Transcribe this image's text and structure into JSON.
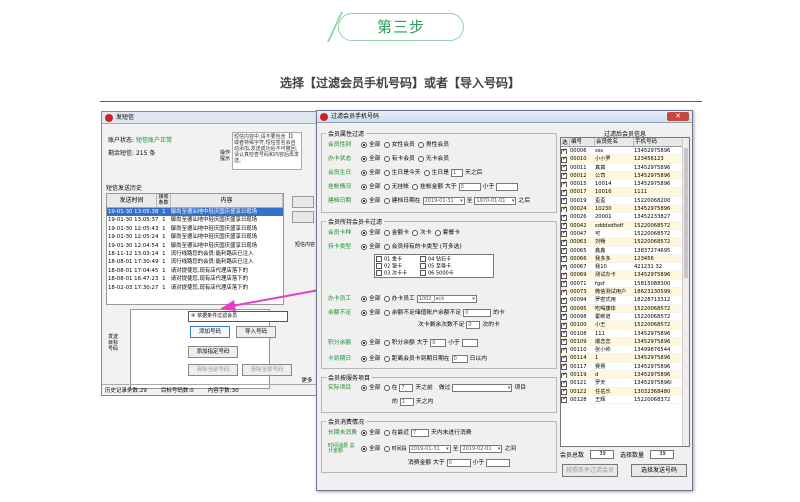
{
  "step": {
    "label": "第三步"
  },
  "instruction": "选择【过滤会员手机号码】或者【导入号码】",
  "back_window": {
    "title": "发短信",
    "account_label": "账户状态:",
    "account_status": "短信账户正常",
    "balance_label": "剩余短信:",
    "balance": "215 条",
    "tip_label": "操作提示",
    "tip_text": "短信内容中,请不要包含【】或者特殊字符,短信签名会自动添加,发送成功后不可撤回,请认真检查号码和内容后再发送。",
    "history_label": "短信发送历史",
    "history_headers": [
      "发送时间",
      "接收条数",
      "内容"
    ],
    "history_rows": [
      {
        "time": "19-01-30 13:05:38",
        "count": "1",
        "body": "御尚至德汕地中轻庆国庆盛享日现场"
      },
      {
        "time": "19-01-30 13:05:37",
        "count": "1",
        "body": "御尚至德汕地中轻庆国庆盛享日现场"
      },
      {
        "time": "19-01-30 12:05:43",
        "count": "1",
        "body": "御尚至德汕地中轻庆国庆盛享日现场"
      },
      {
        "time": "19-01-30 12:05:24",
        "count": "1",
        "body": "御尚至德汕地中轻庆国庆盛享日现场"
      },
      {
        "time": "19-01-30 12:04:54",
        "count": "1",
        "body": "御尚至德汕地中轻庆国庆盛享日现场"
      },
      {
        "time": "18-11-12 13:03:14",
        "count": "1",
        "body": "流行线路您的会员:能利路店已注入"
      },
      {
        "time": "18-08-01 17:30:49",
        "count": "1",
        "body": "流行线路您的会员:能利路店已注入"
      },
      {
        "time": "18-08-01 17:04:45",
        "count": "1",
        "body": "请对提使您,现有店代理店落下的"
      },
      {
        "time": "18-08-01 16:47:23",
        "count": "1",
        "body": "请对提使您,现有店代理店落下的"
      },
      {
        "time": "18-02-03 17:30:27",
        "count": "1",
        "body": "请对提使您,现有店代理店落下的"
      }
    ],
    "side_label": "短信内容",
    "recipient_label": "发送目标号码",
    "combo_value": "④ 依据条件过滤会员",
    "btn_add": "添加号码",
    "btn_import": "导入号码",
    "btn_add_designated": "添加指定号码",
    "btn_clear": "清除当前号码",
    "btn_clear_all": "清除全部号码",
    "btn_more": "更多",
    "status_history": "历史记录条数:29",
    "status_targets": "目标号码数:0",
    "status_chars": "内容字数:30"
  },
  "dialog": {
    "title": "过滤会员手机号码",
    "close_glyph": "✕",
    "g1_title": "会员属性过滤",
    "gender": {
      "label": "会员性别",
      "opts": [
        "全部",
        "女性会员",
        "男性会员"
      ]
    },
    "card_member": {
      "label": "办卡状态",
      "opts": [
        "全部",
        "有卡会员",
        "无卡会员"
      ]
    },
    "birthday": {
      "label": "会员生日",
      "opts": [
        "全部",
        "生日是今天",
        "生日是"
      ],
      "days": "1",
      "suffix": "天之后"
    },
    "debt": {
      "label": "挂帐情况",
      "opts": [
        "全部",
        "无挂帐",
        "挂帐金额 大于"
      ],
      "amount": "0",
      "lt": "小于"
    },
    "created": {
      "label": "建档日期",
      "opts": [
        "全部",
        "建档日期在"
      ],
      "from": "2019-01-31",
      "mid": "至",
      "to": "1970-01-01",
      "suffix": "之后"
    },
    "g2_title": "会员所持会员卡过滤",
    "card_type": {
      "label": "会员卡种",
      "opts": [
        "全部",
        "金额卡",
        "次卡",
        "套餐卡"
      ]
    },
    "card_class": {
      "label": "持卡类型",
      "opts": [
        "全部",
        "会员持有的卡类型 (可多选)"
      ]
    },
    "card_class_list": [
      "01 金卡",
      "02 银卡",
      "03 次卡卡",
      "04 钻石卡",
      "05 至尊卡",
      "06 5000卡"
    ],
    "staff": {
      "label": "办卡员工",
      "opts": [
        "全部",
        "办卡员工"
      ],
      "value": "1002_Jack"
    },
    "balance": {
      "label": "余额不足",
      "opts": [
        "全部",
        "余额不足"
      ],
      "text1": "储值账户余额不足",
      "v1": "0",
      "unit1": "的卡",
      "text2": "次卡剩余次数不足",
      "v2": "0",
      "unit2": "次的卡"
    },
    "points": {
      "label": "积分余额",
      "opts": [
        "全部",
        "积分余额 大于"
      ],
      "gt": "0",
      "lt_label": "小于"
    },
    "expire": {
      "label": "卡到期日",
      "opts": [
        "全部",
        "距离会员卡到期日期在"
      ],
      "days": "0",
      "unit": "日以内"
    },
    "g3_title": "会员按服务项目",
    "service": {
      "label": "实际项目",
      "opts": [
        "全部",
        "在"
      ],
      "days": "7",
      "unit": "天之前",
      "text": "做过",
      "item": "项目",
      "v2": "1",
      "unit2": "天之内"
    },
    "g4_title": "会员消费情况",
    "consume": {
      "label": "长期未消费",
      "opts": [
        "全部",
        "在最近"
      ],
      "days": "7",
      "unit": "天内未进行消费"
    },
    "consume_period": {
      "label": "时间消费 总计金额",
      "opts": [
        "全部",
        "时间段"
      ],
      "from": "2019-01-31",
      "mid": "至",
      "to": "2019-02-01",
      "suffix": "之间",
      "amount_label": "消费金额 大于",
      "amount": "0",
      "lt": "小于"
    },
    "list_title": "过滤后会员信息",
    "list_headers": [
      "选",
      "编号",
      "会员姓名",
      "手机号码"
    ],
    "members": [
      {
        "no": "00006",
        "name": "sss",
        "phone": "13452975896"
      },
      {
        "no": "00010",
        "name": "小小罗",
        "phone": "123456123"
      },
      {
        "no": "00011",
        "name": "真真",
        "phone": "13452975896"
      },
      {
        "no": "00012",
        "name": "公司",
        "phone": "13452975896"
      },
      {
        "no": "00015",
        "name": "10014",
        "phone": "13452975896"
      },
      {
        "no": "00017",
        "name": "10016",
        "phone": "1111"
      },
      {
        "no": "00019",
        "name": "歪歪",
        "phone": "15220068200"
      },
      {
        "no": "00024",
        "name": "10230",
        "phone": "13452975896"
      },
      {
        "no": "00026",
        "name": "20001",
        "phone": "13452233827"
      },
      {
        "no": "00042",
        "name": "sdddsdfsdf",
        "phone": "15220068572"
      },
      {
        "no": "00047",
        "name": "可",
        "phone": "15220068572"
      },
      {
        "no": "00063",
        "name": "刘畅",
        "phone": "15220068572"
      },
      {
        "no": "00065",
        "name": "鑫鑫",
        "phone": "13837274695"
      },
      {
        "no": "00066",
        "name": "我多多",
        "phone": "123456"
      },
      {
        "no": "00067",
        "name": "我10",
        "phone": "421231 32"
      },
      {
        "no": "00069",
        "name": "测试办卡",
        "phone": "13452975896"
      },
      {
        "no": "00071",
        "name": "fgsf",
        "phone": "15815088300"
      },
      {
        "no": "00073",
        "name": "微信测试用户",
        "phone": "18623130599"
      },
      {
        "no": "00094",
        "name": "罗密式用",
        "phone": "18228713312"
      },
      {
        "no": "00095",
        "name": "吃喝康体",
        "phone": "15220068572"
      },
      {
        "no": "00098",
        "name": "霍断道",
        "phone": "15220068572"
      },
      {
        "no": "00100",
        "name": "小王",
        "phone": "15220068572"
      },
      {
        "no": "00108",
        "name": "111",
        "phone": "13452975896"
      },
      {
        "no": "00109",
        "name": "爆恋恋",
        "phone": "13452975896"
      },
      {
        "no": "00110",
        "name": "张小帅",
        "phone": "13499876544"
      },
      {
        "no": "00114",
        "name": "1",
        "phone": "13452975896"
      },
      {
        "no": "00117",
        "name": "赛赛",
        "phone": "13452975896"
      },
      {
        "no": "00119",
        "name": "d",
        "phone": "13452975896"
      },
      {
        "no": "00121",
        "name": "罗天",
        "phone": "13452975896l"
      },
      {
        "no": "00122",
        "name": "任岳乐",
        "phone": "13032368480"
      },
      {
        "no": "00128",
        "name": "王辉",
        "phone": "15220068372"
      }
    ],
    "total_label": "会员总数",
    "total": "39",
    "selected_label": "选择数量",
    "selected": "39",
    "btn_filter": "按照条件过滤会员",
    "btn_send": "选择发送号码"
  }
}
